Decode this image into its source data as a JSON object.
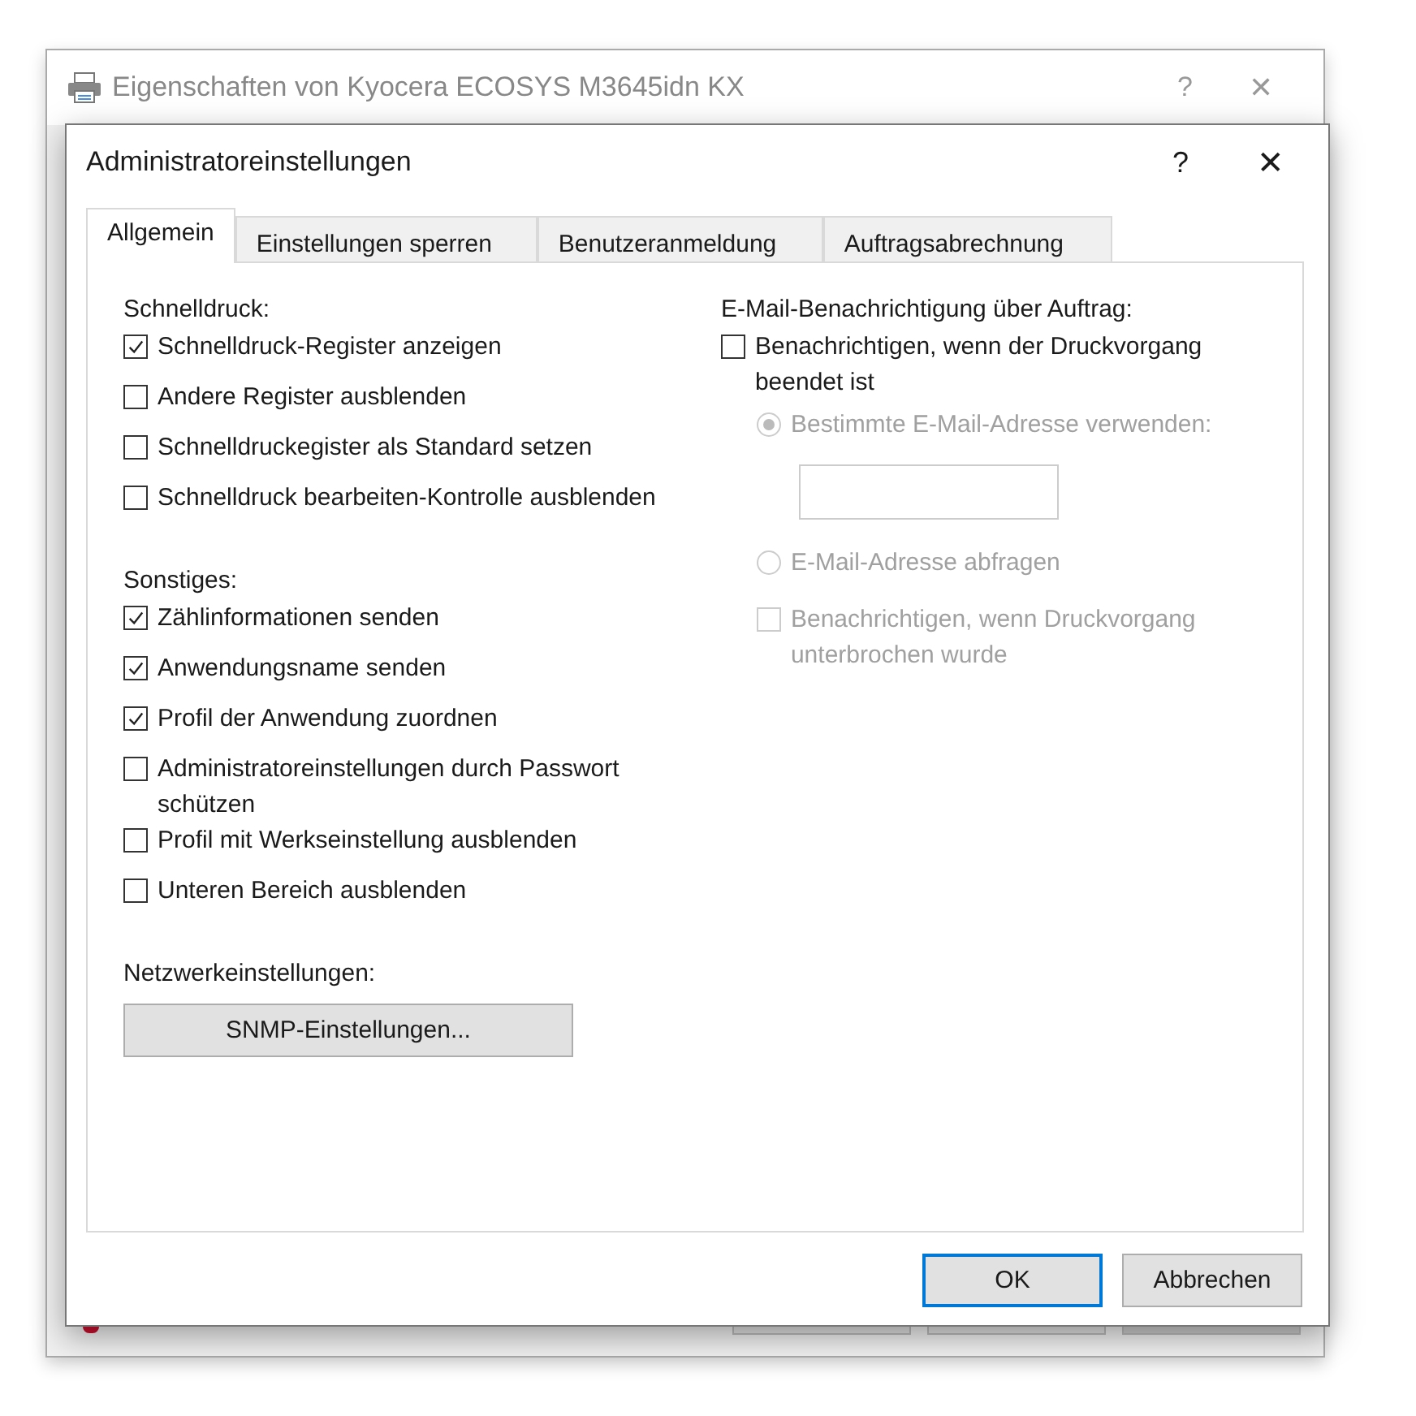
{
  "back_window": {
    "title": "Eigenschaften von Kyocera ECOSYS M3645idn KX",
    "help": "?",
    "close": "✕"
  },
  "dialog": {
    "title": "Administratoreinstellungen",
    "help": "?",
    "close": "✕"
  },
  "tabs": [
    {
      "label": "Allgemein",
      "selected": true
    },
    {
      "label": "Einstellungen sperren",
      "selected": false
    },
    {
      "label": "Benutzeranmeldung",
      "selected": false
    },
    {
      "label": "Auftragsabrechnung",
      "selected": false
    }
  ],
  "left_groups": [
    {
      "heading": "Schnelldruck:",
      "items": [
        {
          "kind": "checkbox",
          "label": "Schnelldruck-Register anzeigen",
          "checked": true,
          "disabled": false
        },
        {
          "kind": "checkbox",
          "label": "Andere Register ausblenden",
          "checked": false,
          "disabled": false
        },
        {
          "kind": "checkbox",
          "label": "Schnelldruckegister als Standard setzen",
          "checked": false,
          "disabled": false
        },
        {
          "kind": "checkbox",
          "label": "Schnelldruck bearbeiten-Kontrolle ausblenden",
          "checked": false,
          "disabled": false
        }
      ]
    },
    {
      "heading": "Sonstiges:",
      "items": [
        {
          "kind": "checkbox",
          "label": "Zählinformationen senden",
          "checked": true,
          "disabled": false
        },
        {
          "kind": "checkbox",
          "label": "Anwendungsname senden",
          "checked": true,
          "disabled": false
        },
        {
          "kind": "checkbox",
          "label": "Profil der Anwendung zuordnen",
          "checked": true,
          "disabled": false
        },
        {
          "kind": "checkbox",
          "label": "Administratoreinstellungen durch Passwort schützen",
          "checked": false,
          "disabled": false
        },
        {
          "kind": "checkbox",
          "label": "Profil mit Werkseinstellung ausblenden",
          "checked": false,
          "disabled": false
        },
        {
          "kind": "checkbox",
          "label": "Unteren Bereich ausblenden",
          "checked": false,
          "disabled": false
        }
      ]
    },
    {
      "heading": "Netzwerkeinstellungen:",
      "items": [
        {
          "kind": "button",
          "label": "SNMP-Einstellungen...",
          "disabled": false
        }
      ]
    }
  ],
  "right_group": {
    "heading": "E-Mail-Benachrichtigung über Auftrag:",
    "items": [
      {
        "kind": "checkbox",
        "label": "Benachrichtigen, wenn der Druckvorgang beendet ist",
        "checked": false,
        "disabled": false
      },
      {
        "kind": "radio",
        "label": "Bestimmte E-Mail-Adresse verwenden:",
        "selected": true,
        "disabled": true
      },
      {
        "kind": "field",
        "disabled": true
      },
      {
        "kind": "radio",
        "label": "E-Mail-Adresse abfragen",
        "selected": false,
        "disabled": true
      },
      {
        "kind": "checkbox",
        "label": "Benachrichtigen, wenn Druckvorgang unterbrochen wurde",
        "checked": false,
        "disabled": true
      }
    ]
  },
  "buttons": [
    {
      "label": "OK",
      "default": true
    },
    {
      "label": "Abbrechen",
      "default": false
    }
  ]
}
